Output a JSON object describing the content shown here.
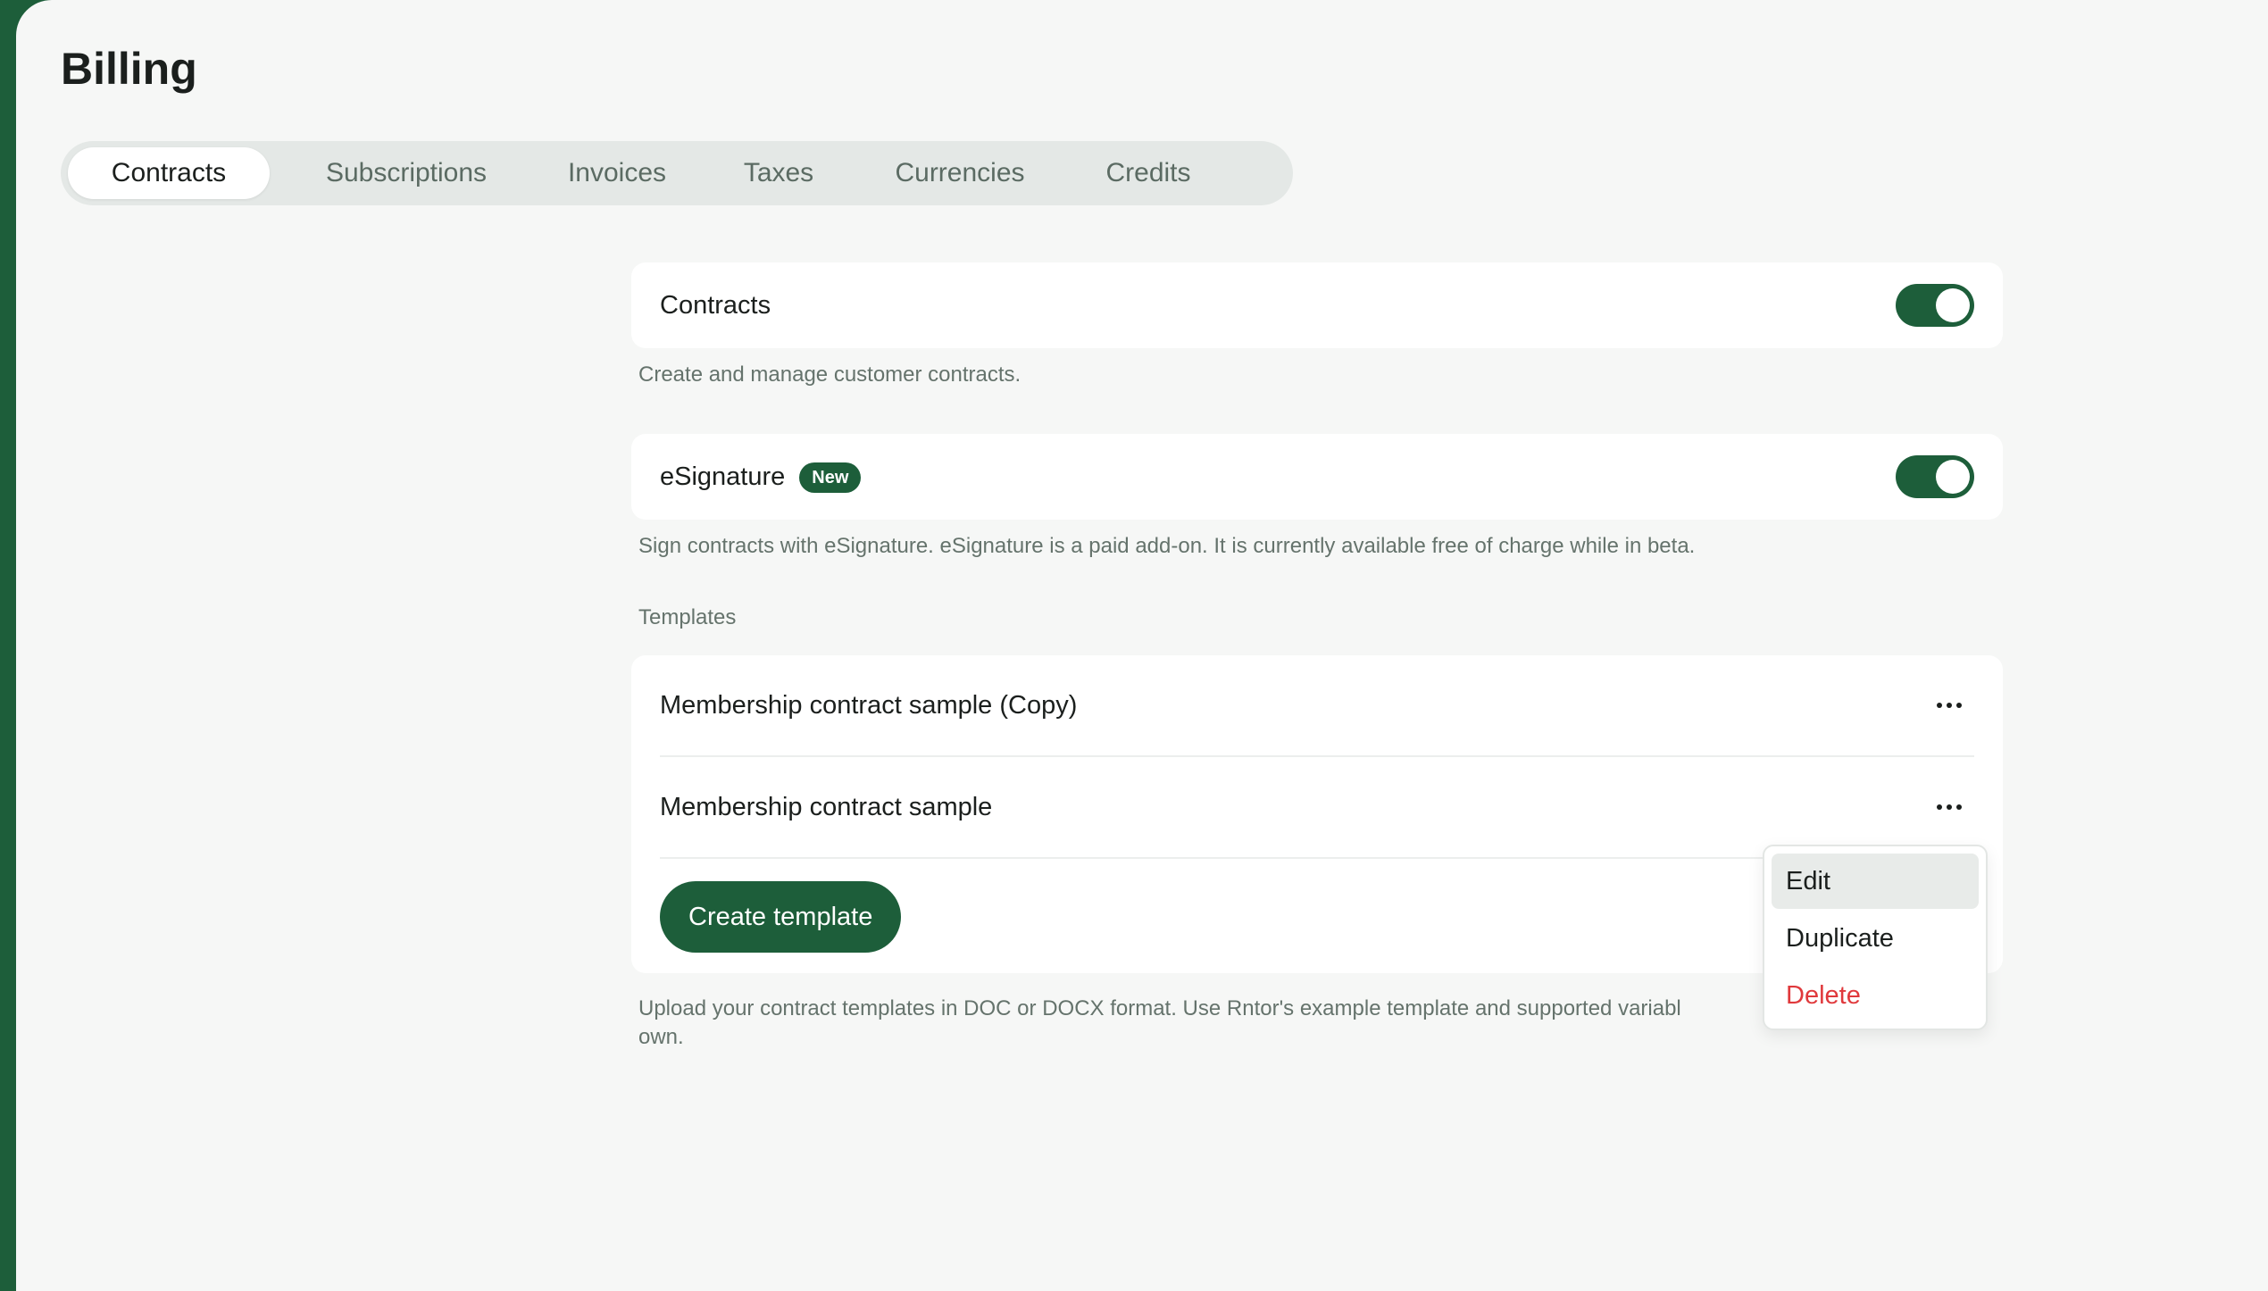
{
  "page": {
    "title": "Billing"
  },
  "tabs": [
    {
      "label": "Contracts",
      "active": true
    },
    {
      "label": "Subscriptions",
      "active": false
    },
    {
      "label": "Invoices",
      "active": false
    },
    {
      "label": "Taxes",
      "active": false
    },
    {
      "label": "Currencies",
      "active": false
    },
    {
      "label": "Credits",
      "active": false
    }
  ],
  "contracts_setting": {
    "label": "Contracts",
    "enabled": true,
    "description": "Create and manage customer contracts."
  },
  "esignature_setting": {
    "label": "eSignature",
    "badge": "New",
    "enabled": true,
    "description": "Sign contracts with eSignature. eSignature is a paid add-on. It is currently available free of charge while in beta."
  },
  "templates": {
    "section_label": "Templates",
    "items": [
      {
        "name": "Membership contract sample (Copy)"
      },
      {
        "name": "Membership contract sample"
      }
    ],
    "create_button": "Create template",
    "help_line1": "Upload your contract templates in DOC or DOCX format. Use Rntor's example template and supported variabl",
    "help_line2": "own."
  },
  "context_menu": {
    "items": [
      {
        "label": "Edit",
        "highlighted": true
      },
      {
        "label": "Duplicate"
      },
      {
        "label": "Delete",
        "destructive": true
      }
    ]
  },
  "colors": {
    "accent": "#1d5e3a",
    "danger": "#e0393c",
    "background": "#f6f7f6"
  },
  "icons": {
    "row_menu": "more-horizontal-icon"
  }
}
